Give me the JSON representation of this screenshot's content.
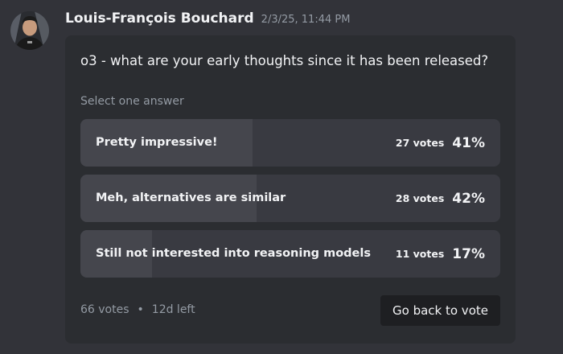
{
  "message": {
    "author": "Louis-François Bouchard",
    "timestamp": "2/3/25, 11:44 PM",
    "avatar_icon": "user-avatar-icon"
  },
  "poll": {
    "question": "o3 - what are your early thoughts since it has been released?",
    "hint": "Select one answer",
    "options": [
      {
        "label": "Pretty impressive!",
        "votes": "27 votes",
        "percent": "41%",
        "fraction": 0.41
      },
      {
        "label": "Meh, alternatives are similar",
        "votes": "28 votes",
        "percent": "42%",
        "fraction": 0.42
      },
      {
        "label": "Still not interested into reasoning models",
        "votes": "11 votes",
        "percent": "17%",
        "fraction": 0.17
      }
    ],
    "total_votes": "66 votes",
    "separator": "•",
    "time_left": "12d left",
    "button_label": "Go back to vote"
  },
  "colors": {
    "background": "#323339",
    "card": "#2b2d31",
    "option_bg": "#393a41",
    "option_fill": "#45464d",
    "muted_text": "#949ba4",
    "button_bg": "#1e1f22"
  }
}
